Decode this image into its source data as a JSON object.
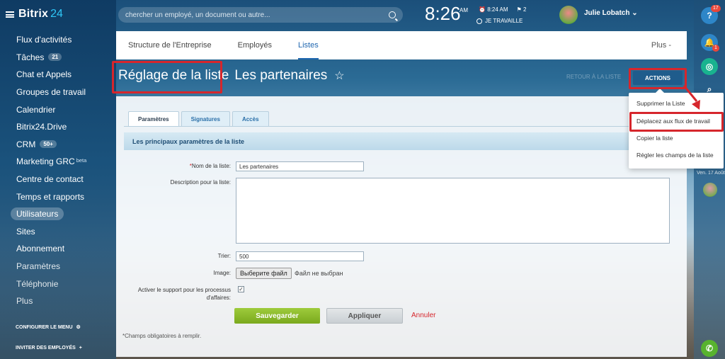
{
  "app": {
    "logo_main": "Bitrix",
    "logo_num": "24"
  },
  "header": {
    "search_placeholder": "chercher un employé, un document ou autre...",
    "clock": "8:26",
    "clock_ampm": "AM",
    "alarm": "8:24 AM",
    "tasks_count": "2",
    "status": "JE TRAVAILLE",
    "user_name": "Julie Lobatch"
  },
  "sidebar": {
    "items": [
      {
        "label": "Flux d'activités"
      },
      {
        "label": "Tâches",
        "count": "21"
      },
      {
        "label": "Chat et Appels"
      },
      {
        "label": "Groupes de travail"
      },
      {
        "label": "Calendrier"
      },
      {
        "label": "Bitrix24.Drive"
      },
      {
        "label": "CRM",
        "count": "50+"
      },
      {
        "label": "Marketing GRC",
        "beta": "beta"
      },
      {
        "label": "Centre de contact"
      },
      {
        "label": "Temps et rapports"
      },
      {
        "label": "Utilisateurs"
      },
      {
        "label": "Sites"
      },
      {
        "label": "Abonnement"
      },
      {
        "label": "Paramètres"
      },
      {
        "label": "Téléphonie"
      },
      {
        "label": "Plus"
      }
    ],
    "configure_menu": "CONFIGURER LE MENU",
    "invite": "INVITER DES EMPLOYÉS"
  },
  "rightbar": {
    "help_badge": "17",
    "bell_badge": "1",
    "date": "Ven. 17 Août"
  },
  "tabs": {
    "items": [
      "Structure de l'Entreprise",
      "Employés",
      "Listes"
    ],
    "active": "Listes",
    "more": "Plus"
  },
  "page": {
    "title_a": "Réglage de la liste",
    "title_b": "Les partenaires",
    "ghost_link": "RETOUR À LA LISTE",
    "actions_label": "ACTIONS"
  },
  "form": {
    "tabs": [
      "Paramètres",
      "Signatures",
      "Accès"
    ],
    "section_title": "Les principaux paramètres de la liste",
    "name_label": "Nom de la liste:",
    "name_value": "Les partenaires",
    "desc_label": "Description pour la liste:",
    "sort_label": "Trier:",
    "sort_value": "500",
    "image_label": "Image:",
    "file_button": "Выберите файл",
    "file_status": "Файл не выбран",
    "bp_label_1": "Activer le support pour les processus",
    "bp_label_2": "d'affaires:",
    "save": "Sauvegarder",
    "apply": "Appliquer",
    "cancel": "Annuler",
    "footnote": "*Champs obligatoires à remplir."
  },
  "dropdown": {
    "items": [
      "Supprimer la Liste",
      "Déplacez aux flux de travail",
      "Copier la liste",
      "Régler les champs de la liste"
    ]
  },
  "colors": {
    "accent": "#2067b0",
    "highlight": "#d6262c",
    "save": "#8cb92c"
  }
}
